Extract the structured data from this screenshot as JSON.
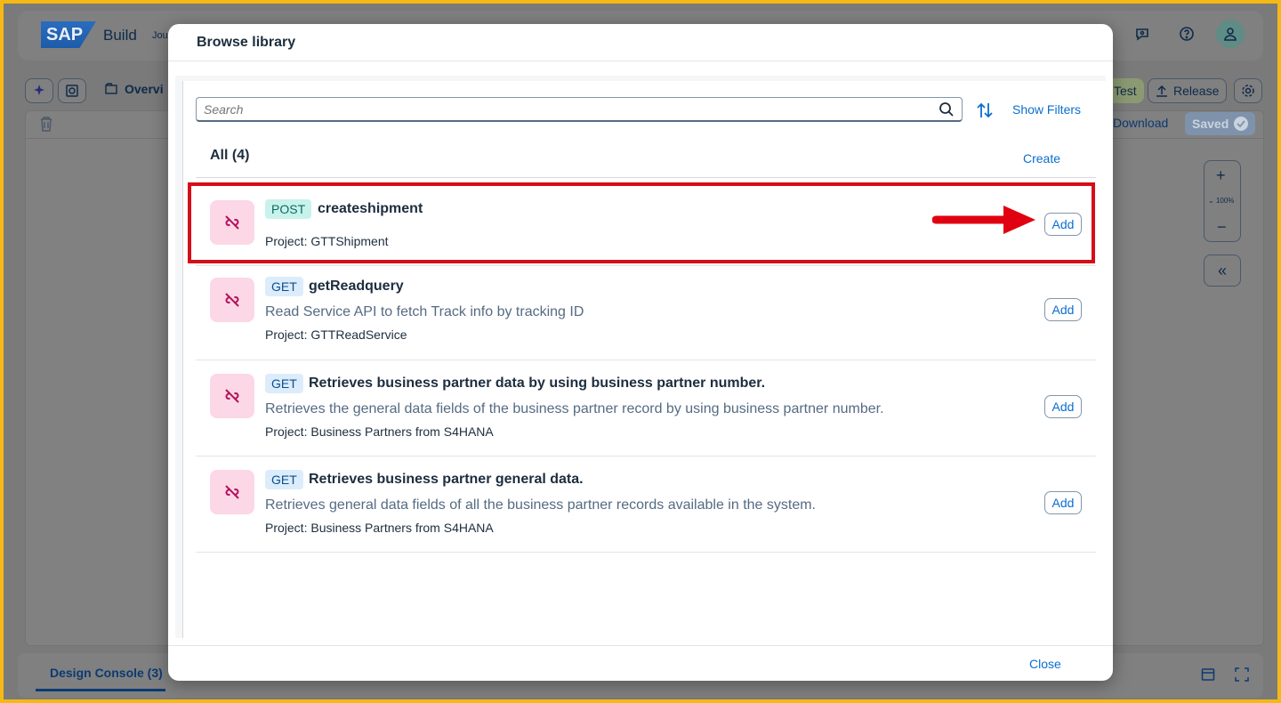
{
  "app": {
    "logo_text": "SAP",
    "product": "Build",
    "breadcrumb_partial": "Jou",
    "overview_partial": "Overvi",
    "buttons": {
      "test_partial": "Test",
      "release": "Release",
      "download": "Download",
      "saved": "Saved"
    },
    "zoom_level": "100%",
    "console_tab": "Design Console (3)"
  },
  "dialog": {
    "title": "Browse library",
    "search_placeholder": "Search",
    "show_filters": "Show Filters",
    "all_count": "All (4)",
    "create": "Create",
    "close": "Close",
    "items": [
      {
        "method": "POST",
        "title": "createshipment",
        "description": "",
        "project": "Project: GTTShipment",
        "add_label": "Add"
      },
      {
        "method": "GET",
        "title": "getReadquery",
        "description": "Read Service API to fetch Track info by tracking ID",
        "project": "Project: GTTReadService",
        "add_label": "Add"
      },
      {
        "method": "GET",
        "title": "Retrieves business partner data by using business partner number.",
        "description": "Retrieves the general data fields of the business partner record by using business partner number.",
        "project": "Project: Business Partners from S4HANA",
        "add_label": "Add"
      },
      {
        "method": "GET",
        "title": "Retrieves business partner general data.",
        "description": "Retrieves general data fields of all the business partner records available in the system.",
        "project": "Project: Business Partners from S4HANA",
        "add_label": "Add"
      }
    ]
  },
  "colors": {
    "accent": "#0a6ed1",
    "highlight": "#d40f17",
    "post_badge": "#c8f2ec",
    "get_badge": "#dcecfb",
    "item_icon_bg": "#fcd7e6"
  }
}
